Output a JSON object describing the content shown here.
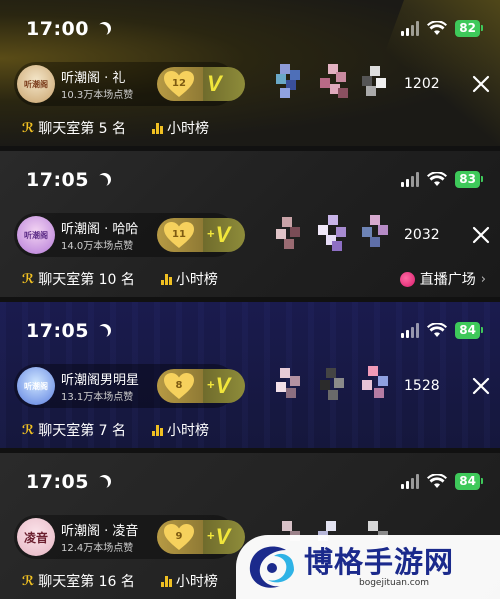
{
  "panels": [
    {
      "time": "17:00",
      "battery": "82",
      "host_name": "听潮阁 · 礼",
      "host_likes": "10.3万本场点赞",
      "level": "12",
      "vip": "V",
      "viewer_count": "1202",
      "rank": "聊天室第 5 名",
      "hour_label": "小时榜",
      "avatar_text": "听潮阁"
    },
    {
      "time": "17:05",
      "battery": "83",
      "host_name": "听潮阁 · 哈哈",
      "host_likes": "14.0万本场点赞",
      "level": "11",
      "vip": "V",
      "viewer_count": "2032",
      "rank": "聊天室第 10 名",
      "hour_label": "小时榜",
      "square": "直播广场",
      "avatar_text": "听潮阁"
    },
    {
      "time": "17:05",
      "battery": "84",
      "host_name": "听潮阁男明星",
      "host_likes": "13.1万本场点赞",
      "level": "8",
      "vip": "V",
      "viewer_count": "1528",
      "rank": "聊天室第 7 名",
      "hour_label": "小时榜",
      "avatar_text": "听潮阁"
    },
    {
      "time": "17:05",
      "battery": "84",
      "host_name": "听潮阁 · 凌音",
      "host_likes": "12.4万本场点赞",
      "level": "9",
      "vip": "V",
      "viewer_count": "",
      "rank": "聊天室第 16 名",
      "hour_label": "小时榜",
      "avatar_text": "凌音"
    }
  ],
  "watermark": {
    "title": "博格手游网",
    "url": "bogejituan.com"
  },
  "colors": {
    "accent_gold": "#f0c022",
    "vip_yellow": "#f1e63b",
    "battery_green": "#3ec95a",
    "live_pink": "#e62a78"
  },
  "icons": [
    "moon-icon",
    "cellular-signal-icon",
    "wifi-icon",
    "battery-icon",
    "heart-level-icon",
    "vip-icon",
    "close-icon",
    "rank-icon",
    "hour-chart-icon",
    "live-square-icon"
  ]
}
